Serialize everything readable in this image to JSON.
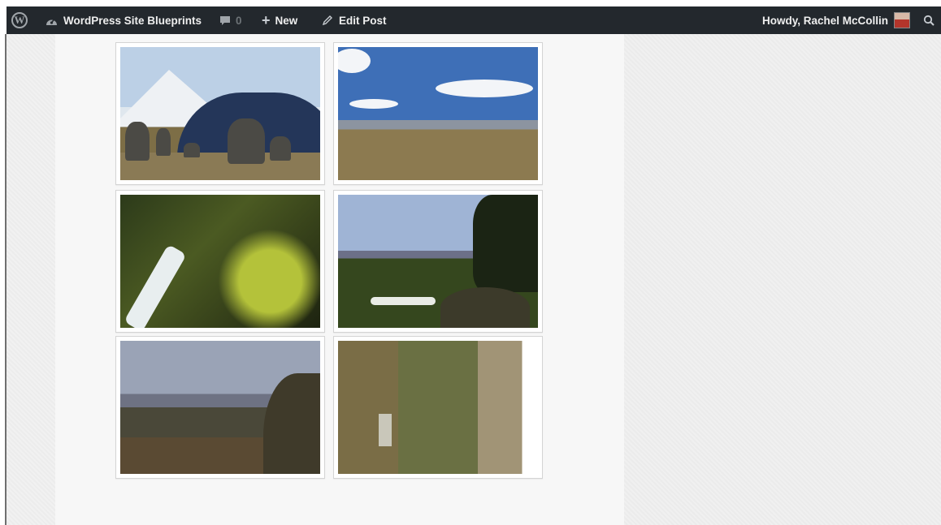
{
  "adminbar": {
    "wp_logo_icon": "wordpress-icon",
    "site_name": "WordPress Site Blueprints",
    "site_icon": "dashboard-icon",
    "comments_count": "0",
    "comments_icon": "comment-bubble-icon",
    "new_label": "New",
    "new_icon": "plus-icon",
    "edit_label": "Edit Post",
    "edit_icon": "pencil-icon",
    "howdy": "Howdy, Rachel McCollin",
    "search_icon": "search-icon",
    "colors": {
      "bar": "#23282d",
      "text": "#eeeeee"
    }
  },
  "gallery": {
    "images": [
      {
        "alt": "stone-circle-mountains"
      },
      {
        "alt": "stone-circle-field"
      },
      {
        "alt": "waterfall-moss"
      },
      {
        "alt": "field-trees-wall"
      },
      {
        "alt": "valley-view"
      },
      {
        "alt": "aerial-valley-rotated"
      }
    ]
  }
}
